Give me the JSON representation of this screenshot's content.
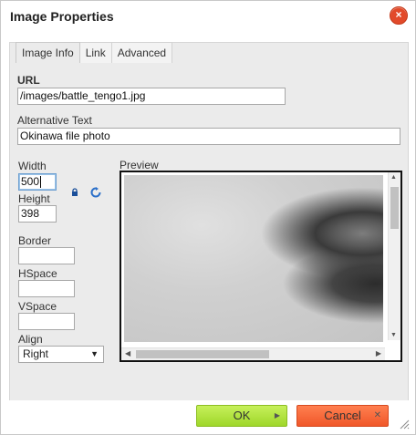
{
  "dialog": {
    "title": "Image Properties",
    "close_glyph": "×"
  },
  "tabs": [
    "Image Info",
    "Link",
    "Advanced"
  ],
  "fields": {
    "url_label": "URL",
    "url_value": "/images/battle_tengo1.jpg",
    "alt_label": "Alternative Text",
    "alt_value": "Okinawa file photo",
    "width_label": "Width",
    "width_value": "500",
    "height_label": "Height",
    "height_value": "398",
    "border_label": "Border",
    "border_value": "",
    "hspace_label": "HSpace",
    "hspace_value": "",
    "vspace_label": "VSpace",
    "vspace_value": "",
    "align_label": "Align",
    "align_value": "Right"
  },
  "preview": {
    "label": "Preview"
  },
  "buttons": {
    "ok_label": "OK",
    "cancel_label": "Cancel"
  },
  "colors": {
    "ok_button": "#a8dc30",
    "cancel_button": "#f25f30",
    "close_button": "#e24a2a",
    "panel_background": "#ebebeb"
  },
  "icons": [
    "close-icon",
    "lock-icon",
    "reset-size-icon",
    "chevron-down-icon",
    "scroll-up-icon",
    "scroll-down-icon",
    "scroll-left-icon",
    "scroll-right-icon",
    "arrow-right-icon",
    "resize-handle-icon"
  ]
}
